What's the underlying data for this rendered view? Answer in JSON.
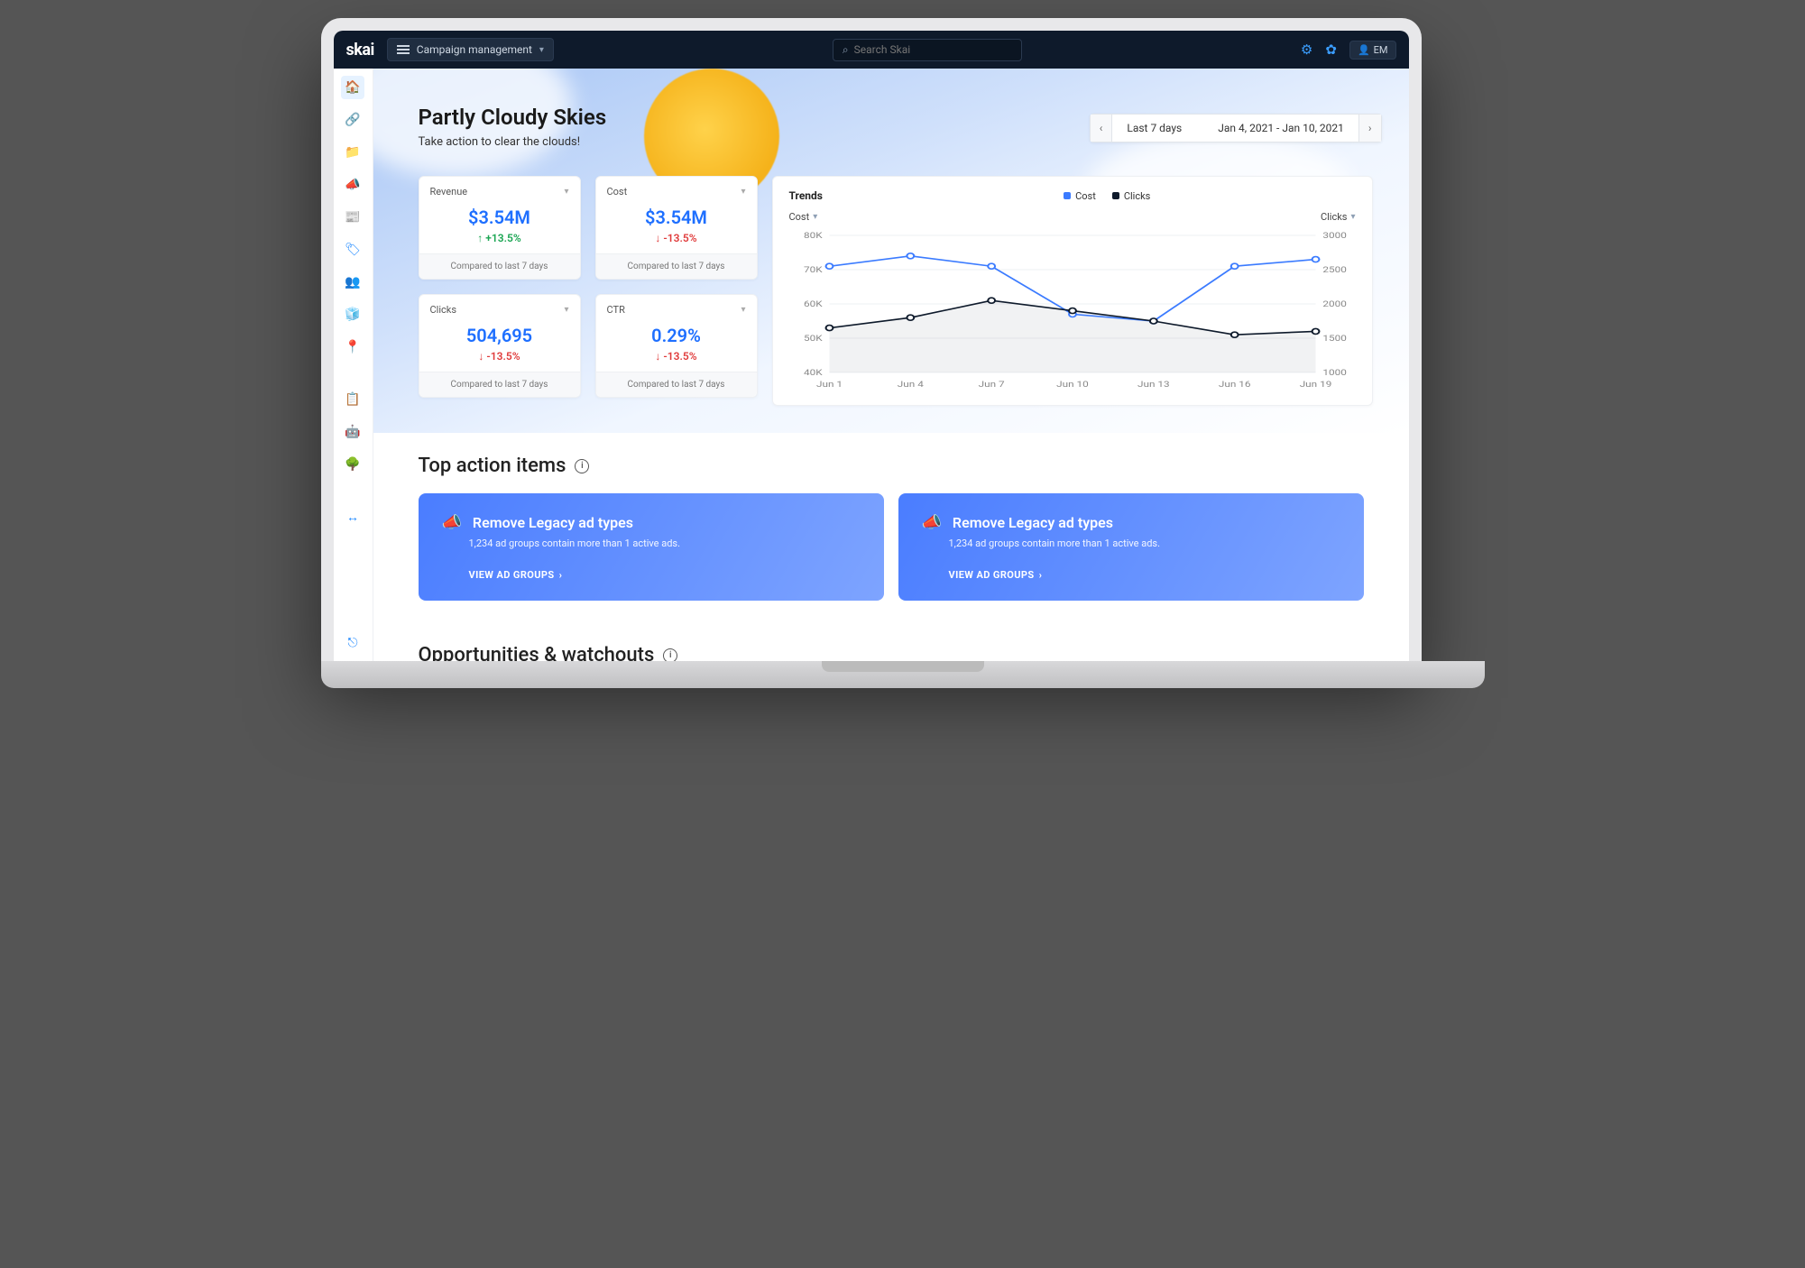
{
  "brand": "skai",
  "nav_label": "Campaign management",
  "search_placeholder": "Search Skai",
  "user_initials": "EM",
  "hero": {
    "title": "Partly Cloudy Skies",
    "subtitle": "Take action to clear the clouds!"
  },
  "date_picker": {
    "label": "Last 7 days",
    "range": "Jan 4, 2021 - Jan 10, 2021"
  },
  "metrics": [
    {
      "name": "Revenue",
      "value": "$3.54M",
      "delta": "+13.5%",
      "dir": "up",
      "compare": "Compared to last 7 days"
    },
    {
      "name": "Cost",
      "value": "$3.54M",
      "delta": "-13.5%",
      "dir": "down",
      "compare": "Compared to last 7 days"
    },
    {
      "name": "Clicks",
      "value": "504,695",
      "delta": "-13.5%",
      "dir": "down",
      "compare": "Compared to last 7 days"
    },
    {
      "name": "CTR",
      "value": "0.29%",
      "delta": "-13.5%",
      "dir": "down",
      "compare": "Compared to last 7 days"
    }
  ],
  "trends": {
    "title": "Trends",
    "legend": [
      {
        "name": "Cost",
        "color": "#3b7bff"
      },
      {
        "name": "Clicks",
        "color": "#0e1a2b"
      }
    ],
    "left_axis_label": "Cost",
    "right_axis_label": "Clicks"
  },
  "chart_data": {
    "type": "line",
    "x": [
      "Jun 1",
      "Jun 4",
      "Jun 7",
      "Jun 10",
      "Jun 13",
      "Jun 16",
      "Jun 19"
    ],
    "left_axis": {
      "label": "Cost",
      "min": 40000,
      "max": 80000,
      "ticks": [
        40000,
        50000,
        60000,
        70000,
        80000
      ],
      "tick_labels": [
        "40K",
        "50K",
        "60K",
        "70K",
        "80K"
      ]
    },
    "right_axis": {
      "label": "Clicks",
      "min": 1000,
      "max": 3000,
      "ticks": [
        1000,
        1500,
        2000,
        2500,
        3000
      ]
    },
    "series": [
      {
        "name": "Cost",
        "axis": "left",
        "color": "#3b7bff",
        "values": [
          71000,
          74000,
          71000,
          57000,
          55000,
          71000,
          73000
        ]
      },
      {
        "name": "Clicks",
        "axis": "right",
        "color": "#0e1a2b",
        "values": [
          1650,
          1800,
          2050,
          1900,
          1750,
          1550,
          1600
        ]
      }
    ]
  },
  "sections": {
    "top_actions_title": "Top action items",
    "opportunities_title": "Opportunities & watchouts"
  },
  "action_items": [
    {
      "title": "Remove Legacy ad types",
      "subtitle": "1,234 ad groups contain more than 1 active ads.",
      "cta": "VIEW AD GROUPS"
    },
    {
      "title": "Remove Legacy ad types",
      "subtitle": "1,234 ad groups contain more than 1 active ads.",
      "cta": "VIEW AD GROUPS"
    }
  ]
}
